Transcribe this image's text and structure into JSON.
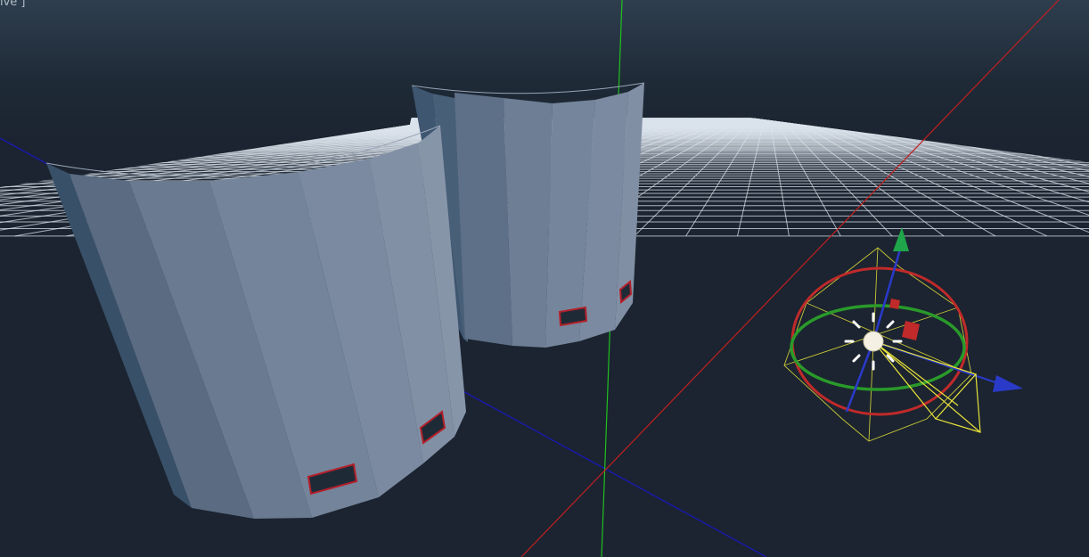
{
  "viewport": {
    "label": "ive ]",
    "background_top": "#2e3e4e",
    "background_bottom": "#1b2430",
    "grid_color": "#dbe3ec"
  },
  "axes": {
    "x_color": "#c02020",
    "y_color": "#20c020",
    "z_color": "#1a1aa8"
  },
  "objects": [
    {
      "name": "curved-wall-front",
      "color": "#7f8fa3"
    },
    {
      "name": "curved-wall-back",
      "color": "#7f8fa3"
    }
  ],
  "gizmo": {
    "icon": "light-bulb-icon",
    "ring_x_color": "#c02a2a",
    "ring_y_color": "#2a9a2a",
    "arrow_y_color": "#1fa64a",
    "arrow_x_color": "#c02a2a",
    "arrow_z_color": "#2a3ac8",
    "light_cone_color": "#e8e23a"
  }
}
